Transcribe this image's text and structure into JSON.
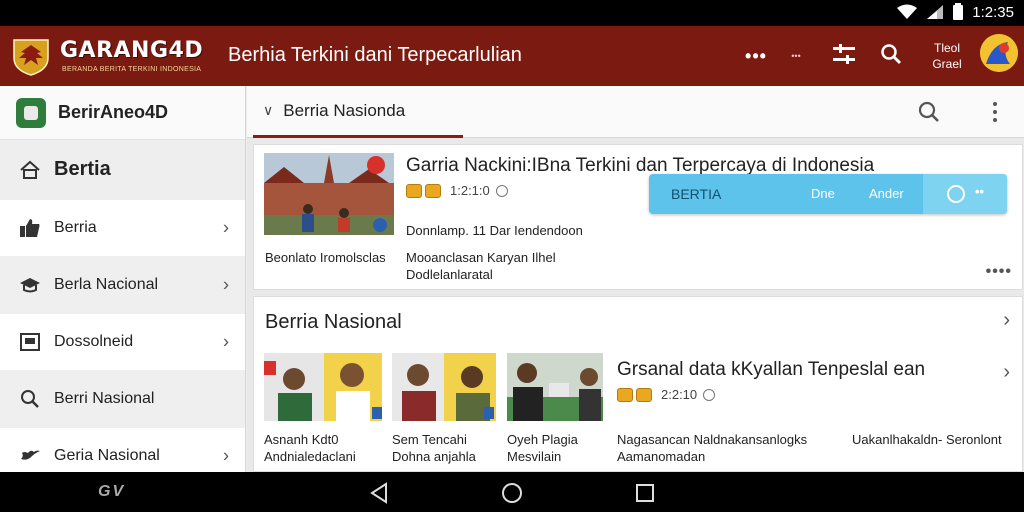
{
  "status_bar": {
    "time": "1:2:35"
  },
  "app_bar": {
    "logo_text": "GARANG4D",
    "logo_subtitle": "BERANDA BERITA TERKINI INDONESIA",
    "title": "Berhia Terkini dani Terpecarlulian",
    "small_label": "•••",
    "user_line1": "Tleol",
    "user_line2": "Grael"
  },
  "sidebar": {
    "header_title": "BerirAneo4D",
    "items": [
      {
        "label": "Bertia",
        "icon": "home-icon",
        "chevron": false
      },
      {
        "label": "Berria",
        "icon": "thumbs-up-icon",
        "chevron": true
      },
      {
        "label": "Berla Nacional",
        "icon": "cap-icon",
        "chevron": true
      },
      {
        "label": "Dossolneid",
        "icon": "news-icon",
        "chevron": true
      },
      {
        "label": "Berri Nasional",
        "icon": "search-icon",
        "chevron": false
      },
      {
        "label": "Geria Nasional",
        "icon": "bird-icon",
        "chevron": true
      }
    ]
  },
  "tab": {
    "label": "Berria Nasionda"
  },
  "card1": {
    "title": "Garria Nackini:IBna Terkini dan Terpercaya di Indonesia",
    "meta_time": "1:2:1:0",
    "subtitle": "Donnlamp. 11 Dar Iendendoon",
    "caption_left": "Beonlato Iromolsclas",
    "caption_right": "Mooanclasan Karyan Ilhel Dodlelanlaratal"
  },
  "chip_bar": {
    "label": "BERTIA",
    "action1": "Dne",
    "action2": "Ander"
  },
  "card2": {
    "heading": "Berria Nasional",
    "feature_title": "Grsanal data kKyallan Tenpeslal ean",
    "meta_time": "2:2:10",
    "captions": [
      "Asnanh Kdt0 Andnialedaclani",
      "Sem Tencahi Dohna anjahla",
      "Oyeh Plagia Mesvilain",
      "Nagasancan Naldnakansanlogks Aamanomadan",
      "Uakanlhakaldn- Seronlont"
    ]
  },
  "nav_bar": {
    "left_label": "GV"
  },
  "colors": {
    "appbar": "#7a1a10",
    "accent": "#8a1c12",
    "chip": "#5ec3ea"
  }
}
